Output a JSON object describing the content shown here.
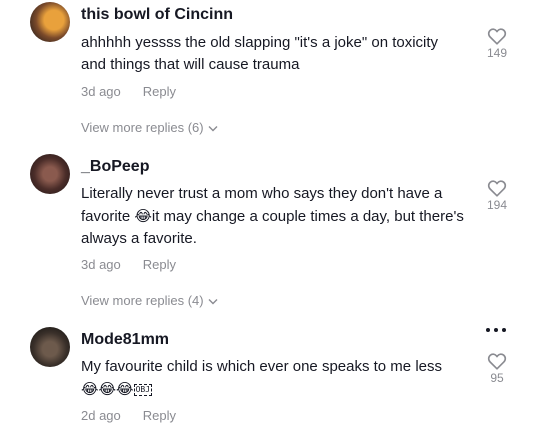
{
  "comments": [
    {
      "username": "this bowl of Cincinn",
      "text": "ahhhhh yessss the old slapping \"it's a joke\" on toxicity and things that will cause trauma",
      "time": "3d ago",
      "reply_label": "Reply",
      "likes": "149",
      "view_more": "View more replies (6)"
    },
    {
      "username": "_BoPeep",
      "text_before": "Literally never trust a mom who says they don't have a favorite ",
      "emoji": "😂",
      "text_after": "it may change a couple times a day, but there's always a favorite.",
      "time": "3d ago",
      "reply_label": "Reply",
      "likes": "194",
      "view_more": "View more replies (4)"
    },
    {
      "username": "Mode81mm",
      "text": "My favourite child is which ever one speaks to me less",
      "emoji": "😂😂😂",
      "tag": "OBJ",
      "time": "2d ago",
      "reply_label": "Reply",
      "likes": "95"
    }
  ],
  "icons": {
    "like": "heart-outline-icon",
    "expand": "chevron-down-icon",
    "more": "more-options-icon"
  },
  "colors": {
    "text": "#161823",
    "secondary": "#8a8b91"
  }
}
